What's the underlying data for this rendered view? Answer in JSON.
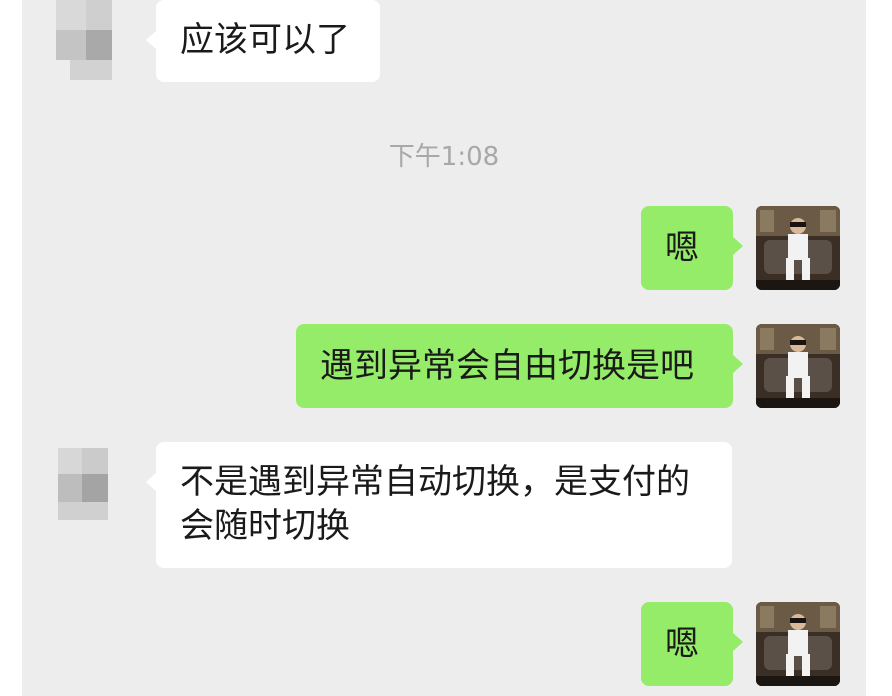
{
  "conversation": {
    "messages": [
      {
        "id": "m1",
        "side": "incoming",
        "text": "应该可以了"
      },
      {
        "id": "m2",
        "side": "outgoing",
        "text": "嗯"
      },
      {
        "id": "m3",
        "side": "outgoing",
        "text": "遇到异常会自由切换是吧"
      },
      {
        "id": "m4",
        "side": "incoming",
        "line1": "不是遇到异常自动切换，是支付的",
        "line2": "会随时切换"
      },
      {
        "id": "m5",
        "side": "outgoing",
        "text": "嗯"
      }
    ],
    "timestamp": "下午1:08"
  },
  "colors": {
    "chat_background": "#ededed",
    "incoming_bubble": "#ffffff",
    "outgoing_bubble": "#95ec69",
    "timestamp_text": "#a8a8a8"
  },
  "icons": {
    "contact_avatar": "blurred-avatar-icon",
    "self_avatar": "user-photo-avatar"
  }
}
